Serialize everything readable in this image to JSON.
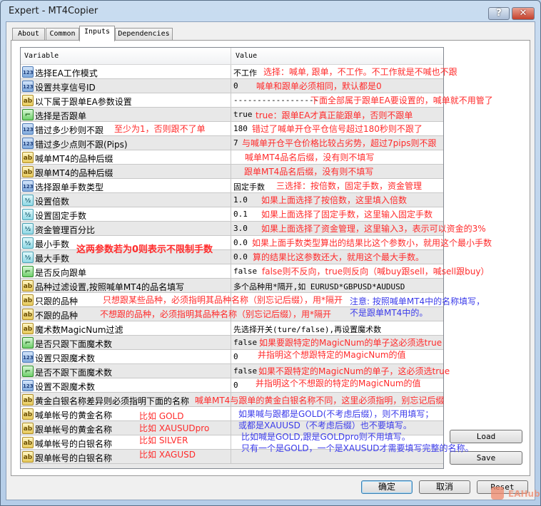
{
  "window": {
    "title": "Expert - MT4Copier",
    "help_label": "?",
    "close_label": "✕"
  },
  "tabs": [
    {
      "label": "About"
    },
    {
      "label": "Common"
    },
    {
      "label": "Inputs",
      "active": true
    },
    {
      "label": "Dependencies"
    }
  ],
  "table": {
    "headers": [
      "Variable",
      "Value"
    ],
    "rows": [
      {
        "name": "选择EA工作模式",
        "icon": "int",
        "value": "不工作"
      },
      {
        "name": "设置共享信号ID",
        "icon": "int",
        "value": "0"
      },
      {
        "name": "以下属于跟单EA参数设置",
        "icon": "string",
        "value": "------------------"
      },
      {
        "name": "选择是否跟单",
        "icon": "bool",
        "value": "true"
      },
      {
        "name": "错过多少秒则不跟",
        "icon": "int",
        "value": "180"
      },
      {
        "name": "错过多少点则不跟(Pips)",
        "icon": "int",
        "value": "7"
      },
      {
        "name": "喊单MT4的品种后缀",
        "icon": "string",
        "value": ""
      },
      {
        "name": "跟单MT4的品种后缀",
        "icon": "string",
        "value": ""
      },
      {
        "name": "选择跟单手数类型",
        "icon": "int",
        "value": "固定手数"
      },
      {
        "name": "设置倍数",
        "icon": "double",
        "value": "1.0"
      },
      {
        "name": "设置固定手数",
        "icon": "double",
        "value": "0.1"
      },
      {
        "name": "资金管理百分比",
        "icon": "double",
        "value": "3.0"
      },
      {
        "name": "最小手数",
        "icon": "double",
        "value": "0.0"
      },
      {
        "name": "最大手数",
        "icon": "double",
        "value": "0.0"
      },
      {
        "name": "是否反向跟单",
        "icon": "bool",
        "value": "false"
      },
      {
        "name": "品种过滤设置,按照喊单MT4的品名填写",
        "icon": "string",
        "value": "多个品种用*隔开,如 EURUSD*GBPUSD*AUDUSD"
      },
      {
        "name": "只跟的品种",
        "icon": "string",
        "value": ""
      },
      {
        "name": "不跟的品种",
        "icon": "string",
        "value": ""
      },
      {
        "name": "魔术数MagicNum过滤",
        "icon": "string",
        "value": "先选择开关(ture/false),再设置魔术数"
      },
      {
        "name": "是否只跟下面魔术数",
        "icon": "bool",
        "value": "false"
      },
      {
        "name": "设置只跟魔术数",
        "icon": "int",
        "value": "0"
      },
      {
        "name": "是否不跟下面魔术数",
        "icon": "bool",
        "value": "false"
      },
      {
        "name": "设置不跟魔术数",
        "icon": "int",
        "value": "0"
      },
      {
        "name": "黄金白银名称差异则必须指明下面的名称",
        "icon": "string",
        "value": ""
      },
      {
        "name": "喊单帐号的黄金名称",
        "icon": "string",
        "value": ""
      },
      {
        "name": "跟单帐号的黄金名称",
        "icon": "string",
        "value": ""
      },
      {
        "name": "喊单帐号的白银名称",
        "icon": "string",
        "value": ""
      },
      {
        "name": "跟单帐号的白银名称",
        "icon": "string",
        "value": ""
      }
    ]
  },
  "annotations": [
    {
      "text": "选择：喊单, 跟单，不工作。不工作就是不喊也不跟",
      "color": "red"
    },
    {
      "text": "喊单和跟单必须相同，默认都是0",
      "color": "red"
    },
    {
      "text": "下面全部属于跟单EA要设置的，喊单就不用管了",
      "color": "red"
    },
    {
      "text": "true：跟单EA才真正能跟单，否则不跟单",
      "color": "red"
    },
    {
      "text": "至少为1，否则跟不了单",
      "color": "red"
    },
    {
      "text": "错过了喊单开仓平仓信号超过180秒则不跟了",
      "color": "red"
    },
    {
      "text": "与喊单开仓平仓价格比较占劣势，超过7pips则不跟",
      "color": "red"
    },
    {
      "text": "喊单MT4品名后缀，没有则不填写",
      "color": "red"
    },
    {
      "text": "跟单MT4品名后缀，没有则不填写",
      "color": "red"
    },
    {
      "text": "三选择：按倍数，固定手数，资金管理",
      "color": "red"
    },
    {
      "text": "如果上面选择了按倍数，这里填入倍数",
      "color": "red"
    },
    {
      "text": "如果上面选择了固定手数，这里输入固定手数",
      "color": "red"
    },
    {
      "text": "如果上面选择了资金管理，这里输入3，表示可以资金的3%",
      "color": "red"
    },
    {
      "text": "如果上面手数类型算出的结果比这个参数小，就用这个最小手数",
      "color": "red"
    },
    {
      "text": "算的结果比这参数还大，就用这个最大手数。",
      "color": "red"
    },
    {
      "text": "这两参数若为0则表示不限制手数",
      "color": "red",
      "bold": true
    },
    {
      "text": "false则不反向，true则反向（喊buy跟sell，喊sell跟buy）",
      "color": "red"
    },
    {
      "text": "只想跟某些品种，必须指明其品种名称（别忘记后缀），用*隔开",
      "color": "red"
    },
    {
      "text": "注意: 按照喊单MT4中的名称填写，",
      "color": "blue"
    },
    {
      "text": "不想跟的品种，必须指明其品种名称（别忘记后缀），用*隔开",
      "color": "red"
    },
    {
      "text": "不是跟单MT4中的。",
      "color": "blue"
    },
    {
      "text": "如果要跟特定的MagicNum的单子这必须选true",
      "color": "red"
    },
    {
      "text": "并指明这个想跟特定的MagicNum的值",
      "color": "red"
    },
    {
      "text": "如果不跟特定的MagicNum的单子，这必须选true",
      "color": "red"
    },
    {
      "text": "并指明这个不想跟的特定的MagicNum的值",
      "color": "red"
    },
    {
      "text": "喊单MT4与跟单的黄金白银名称不同，这里必须指明，别忘记后缀",
      "color": "red"
    },
    {
      "text": "比如 GOLD",
      "color": "red"
    },
    {
      "text": "比如 XAUSUDpro",
      "color": "red"
    },
    {
      "text": "比如 SILVER",
      "color": "red"
    },
    {
      "text": "比如 XAGUSD",
      "color": "red"
    },
    {
      "text": "如果喊与跟都是GOLD(不考虑后缀），则不用填写；",
      "color": "blue"
    },
    {
      "text": "或都是XAUUSD（不考虑后缀）也不要填写。",
      "color": "blue"
    },
    {
      "text": "比如喊是GOLD,跟是GOLDpro则不用填写。",
      "color": "blue"
    },
    {
      "text": "只有一个是GOLD，一个是XAUSUD才需要填写完整的名称。",
      "color": "blue"
    }
  ],
  "side_buttons": {
    "load": "Load",
    "save": "Save"
  },
  "footer": {
    "ok": "确定",
    "cancel": "取消",
    "reset": "Reset"
  },
  "watermark": "EAHub",
  "colors": {
    "annotation_red": "#ff2b2b",
    "annotation_blue": "#3b3bea"
  }
}
